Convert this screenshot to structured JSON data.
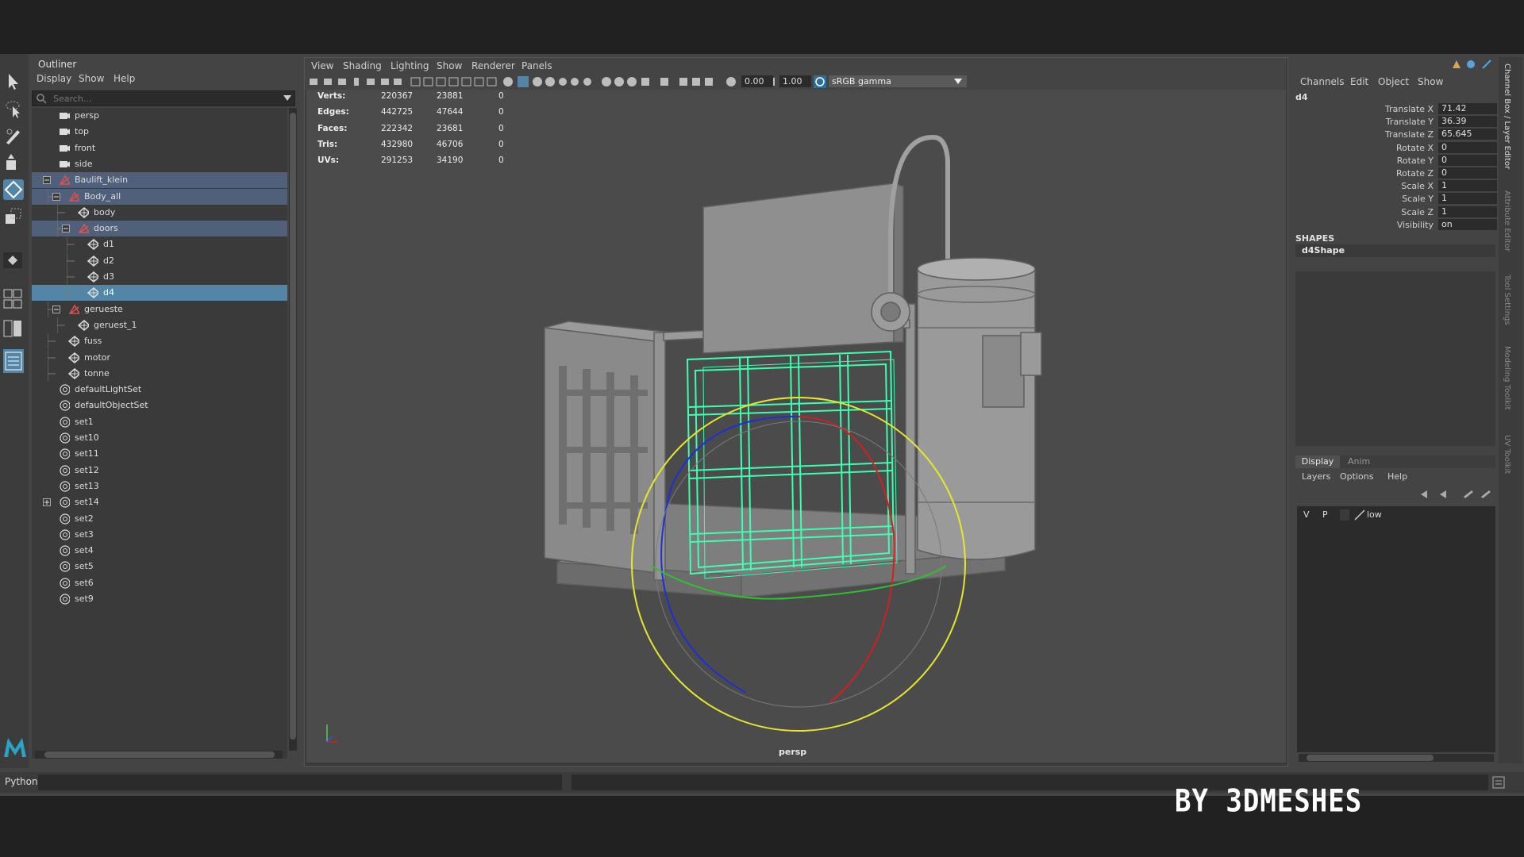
{
  "outliner": {
    "title": "Outliner",
    "menu": [
      "Display",
      "Show",
      "Help"
    ],
    "search_placeholder": "Search...",
    "items": [
      {
        "label": "persp",
        "indent": 0,
        "icon": "camera-icon"
      },
      {
        "label": "top",
        "indent": 0,
        "icon": "camera-icon"
      },
      {
        "label": "front",
        "indent": 0,
        "icon": "camera-icon"
      },
      {
        "label": "side",
        "indent": 0,
        "icon": "camera-icon"
      },
      {
        "label": "Baulift_klein",
        "indent": 0,
        "icon": "group-icon",
        "expander": "minus",
        "state": "highlight"
      },
      {
        "label": "Body_all",
        "indent": 1,
        "icon": "group-icon",
        "expander": "minus",
        "state": "highlight"
      },
      {
        "label": "body",
        "indent": 2,
        "icon": "mesh-icon"
      },
      {
        "label": "doors",
        "indent": 2,
        "icon": "group-icon",
        "expander": "minus",
        "state": "highlight"
      },
      {
        "label": "d1",
        "indent": 3,
        "icon": "mesh-icon"
      },
      {
        "label": "d2",
        "indent": 3,
        "icon": "mesh-icon"
      },
      {
        "label": "d3",
        "indent": 3,
        "icon": "mesh-icon"
      },
      {
        "label": "d4",
        "indent": 3,
        "icon": "mesh-icon",
        "state": "selected"
      },
      {
        "label": "gerueste",
        "indent": 1,
        "icon": "group-icon",
        "expander": "minus"
      },
      {
        "label": "geruest_1",
        "indent": 2,
        "icon": "mesh-icon"
      },
      {
        "label": "fuss",
        "indent": 1,
        "icon": "mesh-icon"
      },
      {
        "label": "motor",
        "indent": 1,
        "icon": "mesh-icon"
      },
      {
        "label": "tonne",
        "indent": 1,
        "icon": "mesh-icon"
      },
      {
        "label": "defaultLightSet",
        "indent": 0,
        "icon": "set-icon"
      },
      {
        "label": "defaultObjectSet",
        "indent": 0,
        "icon": "set-icon"
      },
      {
        "label": "set1",
        "indent": 0,
        "icon": "set-icon"
      },
      {
        "label": "set10",
        "indent": 0,
        "icon": "set-icon"
      },
      {
        "label": "set11",
        "indent": 0,
        "icon": "set-icon"
      },
      {
        "label": "set12",
        "indent": 0,
        "icon": "set-icon"
      },
      {
        "label": "set13",
        "indent": 0,
        "icon": "set-icon"
      },
      {
        "label": "set14",
        "indent": 0,
        "icon": "set-icon",
        "expander": "plus"
      },
      {
        "label": "set2",
        "indent": 0,
        "icon": "set-icon"
      },
      {
        "label": "set3",
        "indent": 0,
        "icon": "set-icon"
      },
      {
        "label": "set4",
        "indent": 0,
        "icon": "set-icon"
      },
      {
        "label": "set5",
        "indent": 0,
        "icon": "set-icon"
      },
      {
        "label": "set6",
        "indent": 0,
        "icon": "set-icon"
      },
      {
        "label": "set9",
        "indent": 0,
        "icon": "set-icon"
      }
    ]
  },
  "viewport": {
    "menu": [
      "View",
      "Shading",
      "Lighting",
      "Show",
      "Renderer",
      "Panels"
    ],
    "exposure": "0.00",
    "gamma": "1.00",
    "color_space": "sRGB gamma",
    "camera_label": "persp",
    "hud": [
      {
        "label": "Verts:",
        "v1": "220367",
        "v2": "23881",
        "v3": "0"
      },
      {
        "label": "Edges:",
        "v1": "442725",
        "v2": "47644",
        "v3": "0"
      },
      {
        "label": "Faces:",
        "v1": "222342",
        "v2": "23681",
        "v3": "0"
      },
      {
        "label": "Tris:",
        "v1": "432980",
        "v2": "46706",
        "v3": "0"
      },
      {
        "label": "UVs:",
        "v1": "291253",
        "v2": "34190",
        "v3": "0"
      }
    ]
  },
  "channelbox": {
    "menu": [
      "Channels",
      "Edit",
      "Object",
      "Show"
    ],
    "object_name": "d4",
    "channels": [
      {
        "label": "Translate X",
        "value": "71.42"
      },
      {
        "label": "Translate Y",
        "value": "36.39"
      },
      {
        "label": "Translate Z",
        "value": "65.645"
      },
      {
        "label": "Rotate X",
        "value": "0"
      },
      {
        "label": "Rotate Y",
        "value": "0"
      },
      {
        "label": "Rotate Z",
        "value": "0"
      },
      {
        "label": "Scale X",
        "value": "1"
      },
      {
        "label": "Scale Y",
        "value": "1"
      },
      {
        "label": "Scale Z",
        "value": "1"
      },
      {
        "label": "Visibility",
        "value": "on"
      }
    ],
    "shapes_header": "SHAPES",
    "shape_name": "d4Shape"
  },
  "layers": {
    "tabs": [
      "Display",
      "Anim"
    ],
    "menu": [
      "Layers",
      "Options",
      "Help"
    ],
    "layer": {
      "v": "V",
      "p": "P",
      "name": "low"
    }
  },
  "side_tabs": [
    "Channel Box / Layer Editor",
    "Attribute Editor",
    "Tool Settings",
    "Modeling Toolkit",
    "UV Toolkit"
  ],
  "command_line": {
    "label": "Python"
  },
  "watermark": "BY 3DMESHES",
  "colors": {
    "selection": "#5285a6",
    "wire": "#3dffb0",
    "manip_yellow": "#e6e62e"
  }
}
